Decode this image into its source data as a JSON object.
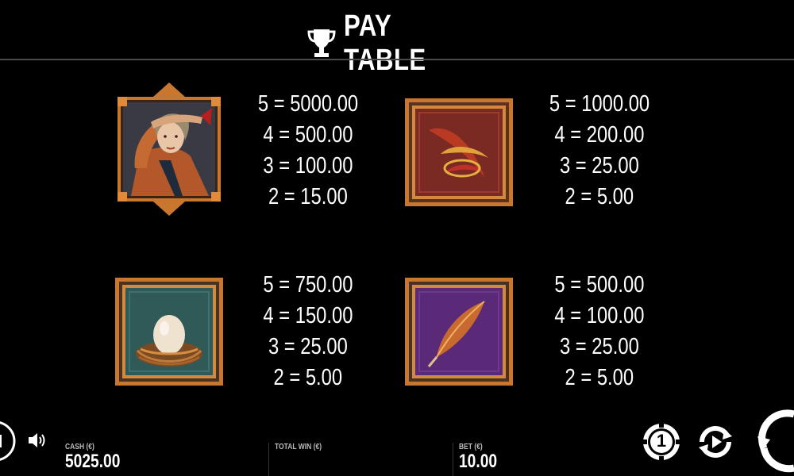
{
  "header": {
    "title": "PAY TABLE",
    "icon": "trophy-icon"
  },
  "paytable": [
    {
      "symbol": "scout-woman-symbol",
      "pays": [
        "5 = 5000.00",
        "4 = 500.00",
        "3 = 100.00",
        "2 = 15.00"
      ]
    },
    {
      "symbol": "red-feathers-symbol",
      "pays": [
        "5 = 1000.00",
        "4 = 200.00",
        "3 = 25.00",
        "2 = 5.00"
      ]
    },
    {
      "symbol": "egg-nest-symbol",
      "pays": [
        "5 = 750.00",
        "4 = 150.00",
        "3 = 25.00",
        "2 = 5.00"
      ]
    },
    {
      "symbol": "quill-feather-symbol",
      "pays": [
        "5 = 500.00",
        "4 = 100.00",
        "3 = 25.00",
        "2 = 5.00"
      ]
    }
  ],
  "footer": {
    "cash_label": "CASH (€)",
    "cash_value": "5025.00",
    "total_win_label": "TOTAL WIN (€)",
    "bet_label": "BET (€)",
    "bet_value": "10.00",
    "coin_value": "1"
  },
  "colors": {
    "background": "#000000",
    "divider": "#4a4a4a",
    "frame_gold": "#c9762e",
    "tile_red": "#7a2a22",
    "tile_teal": "#2f5a58",
    "tile_purple": "#5a2a78"
  }
}
